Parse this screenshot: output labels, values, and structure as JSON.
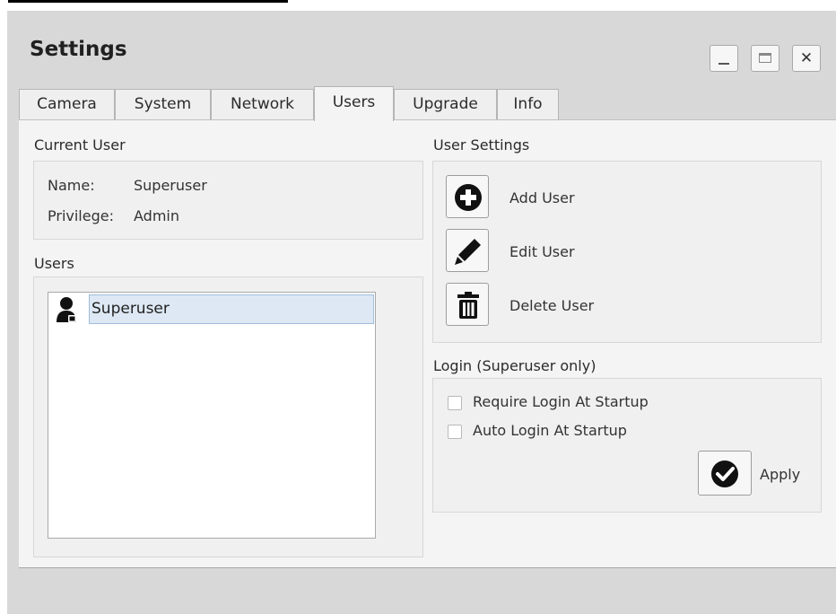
{
  "window": {
    "title": "Settings",
    "controls": {
      "minimize": "minimize-icon",
      "maximize": "maximize-icon",
      "close": "close-icon"
    }
  },
  "tabs": [
    {
      "label": "Camera"
    },
    {
      "label": "System"
    },
    {
      "label": "Network"
    },
    {
      "label": "Users",
      "active": true
    },
    {
      "label": "Upgrade"
    },
    {
      "label": "Info"
    }
  ],
  "current_user": {
    "group_label": "Current User",
    "name_key": "Name:",
    "name_value": "Superuser",
    "privilege_key": "Privilege:",
    "privilege_value": "Admin"
  },
  "users": {
    "group_label": "Users",
    "items": [
      {
        "name": "Superuser",
        "icon": "user-lock-icon",
        "selected": true
      }
    ]
  },
  "user_settings": {
    "group_label": "User Settings",
    "add_label": "Add User",
    "edit_label": "Edit User",
    "delete_label": "Delete User"
  },
  "login": {
    "group_label": "Login (Superuser only)",
    "require_label": "Require Login At Startup",
    "require_checked": false,
    "auto_label": "Auto Login At Startup",
    "auto_checked": false,
    "apply_label": "Apply"
  }
}
